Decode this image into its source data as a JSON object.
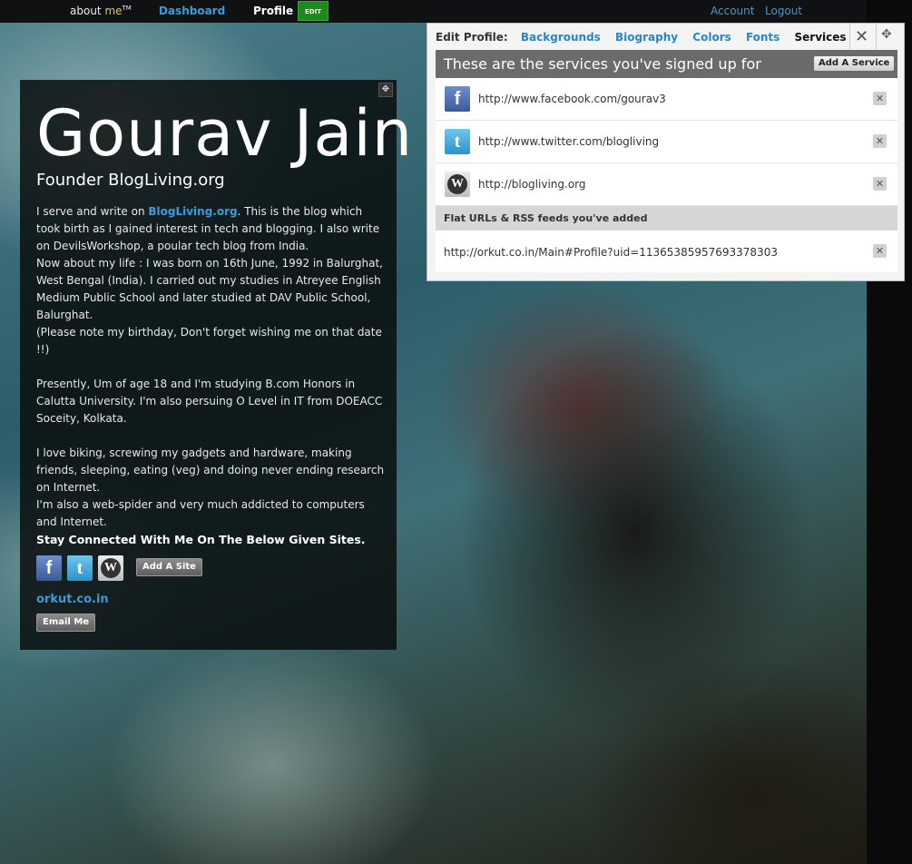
{
  "topbar": {
    "logo_about": "about",
    "logo_me": "me",
    "logo_tm": "TM",
    "nav_dashboard": "Dashboard",
    "nav_profile": "Profile",
    "edit_badge": "EDIT",
    "account": "Account",
    "logout": "Logout"
  },
  "profile": {
    "name": "Gourav Jain",
    "tagline": "Founder BlogLiving.org",
    "bio": {
      "p1_before_link": "I serve and write on ",
      "p1_link": "BlogLiving.org",
      "p1_after_link": ". This is the blog which took birth as I gained interest in tech and blogging. I also write on DevilsWorkshop, a poular tech blog from India.",
      "p2": "Now about my life : I was born on 16th June, 1992 in Balurghat, West Bengal (India). I carried out my studies in Atreyee English Medium Public School and later studied at DAV Public School, Balurghat.",
      "p3": "(Please note my birthday, Don't forget wishing me on that date !!)",
      "p4": "Presently, Um of age 18 and I'm studying B.com Honors in Calutta University. I'm also persuing O Level in IT from DOEACC Soceity, Kolkata.",
      "p5": "I love biking, screwing my gadgets and hardware, making friends, sleeping, eating (veg) and doing never ending research on Internet.",
      "p6": "I'm also a web-spider and very much addicted to computers and Internet.",
      "p7": "Stay Connected With Me On The Below Given Sites."
    },
    "add_site": "Add A Site",
    "orkut_link": "orkut.co.in",
    "email_button": "Email Me"
  },
  "edit_panel": {
    "tabs_label": "Edit Profile:",
    "tabs": [
      "Backgrounds",
      "Biography",
      "Colors",
      "Fonts",
      "Services"
    ],
    "active_tab": "Services",
    "close_glyph": "✕",
    "move_glyph": "✥",
    "header": "These are the services you've signed up for",
    "add_service": "Add A Service",
    "services": [
      {
        "icon": "facebook-icon",
        "url": "http://www.facebook.com/gourav3"
      },
      {
        "icon": "twitter-icon",
        "url": "http://www.twitter.com/blogliving"
      },
      {
        "icon": "wordpress-icon",
        "url": "http://blogliving.org"
      }
    ],
    "feeds_header": "Flat URLs & RSS feeds you've added",
    "feeds": [
      {
        "url": "http://orkut.co.in/Main#Profile?uid=11365385957693378303"
      }
    ],
    "delete_glyph": "✕"
  },
  "colors": {
    "link_blue": "#3c9bd6",
    "edit_green": "#1d8a1d",
    "panel_header": "#6b6b6b"
  }
}
